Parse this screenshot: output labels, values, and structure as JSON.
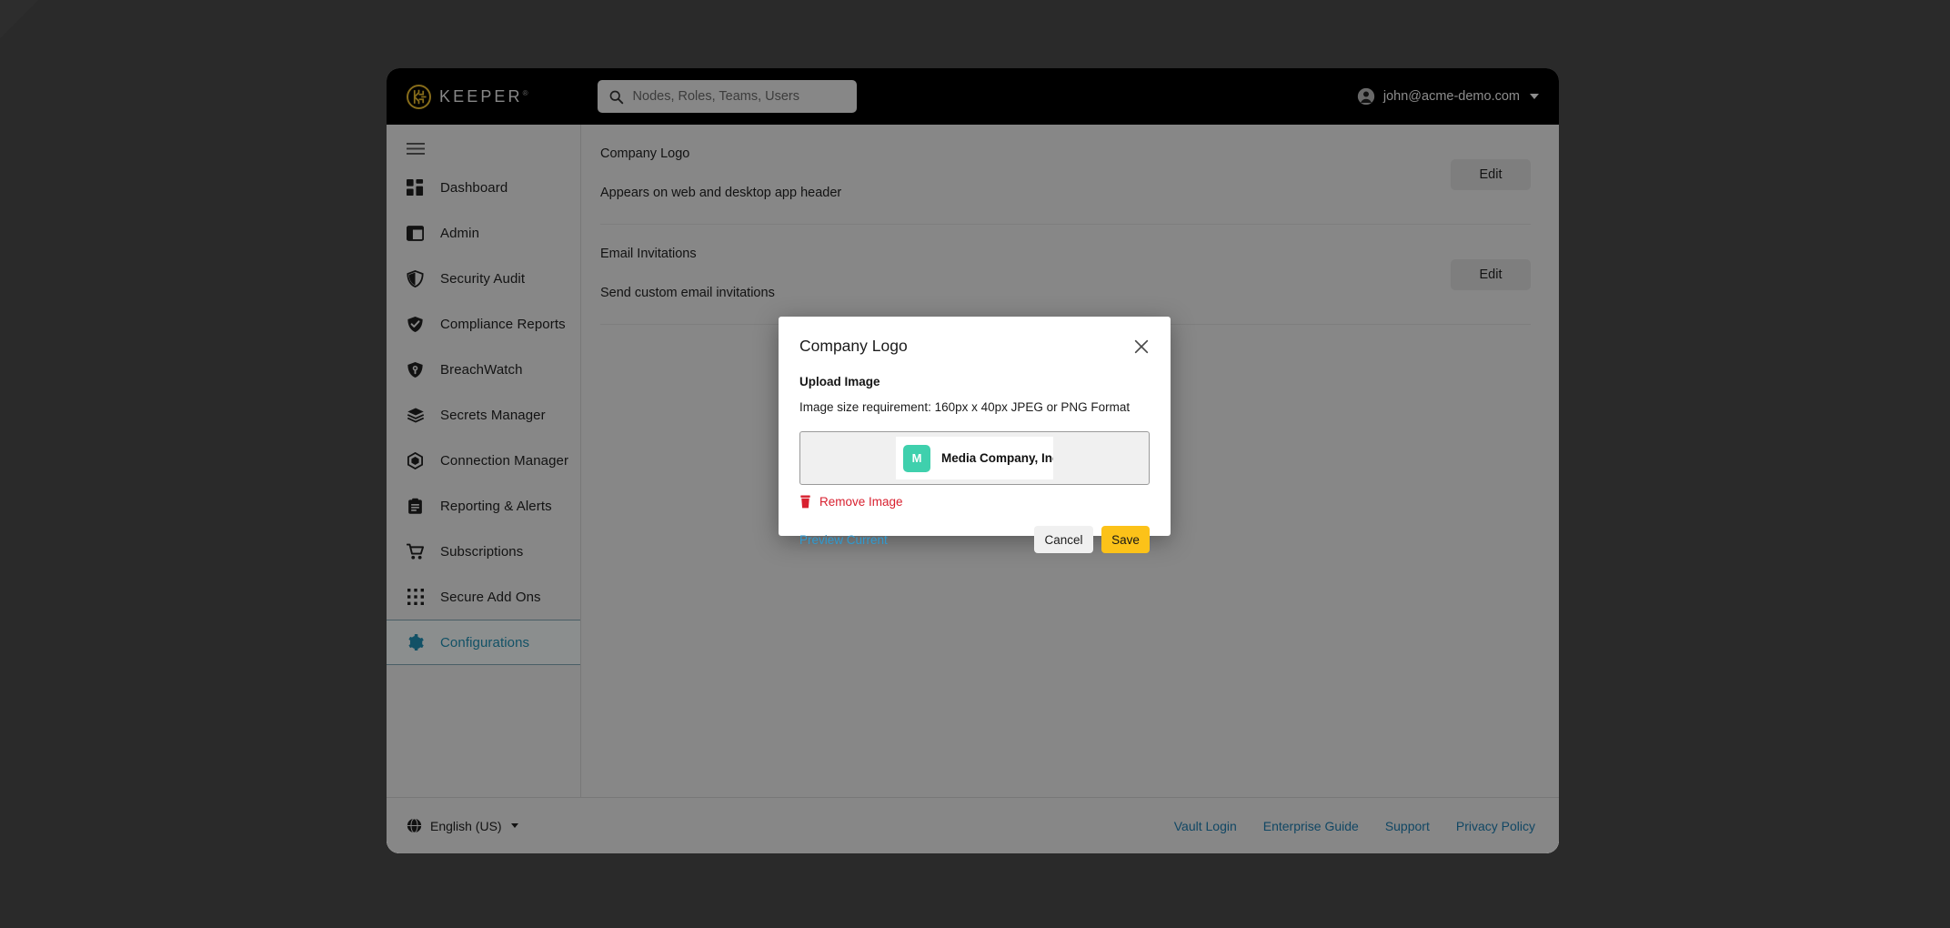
{
  "app": {
    "brand_name": "KEEPER",
    "brand_tm": "®"
  },
  "search": {
    "placeholder": "Nodes, Roles, Teams, Users",
    "value": ""
  },
  "account": {
    "email": "john@acme-demo.com"
  },
  "sidebar": {
    "items": [
      {
        "label": "Dashboard",
        "icon": "dashboard-grid-icon",
        "active": false
      },
      {
        "label": "Admin",
        "icon": "admin-panel-icon",
        "active": false
      },
      {
        "label": "Security Audit",
        "icon": "shield-half-icon",
        "active": false
      },
      {
        "label": "Compliance Reports",
        "icon": "shield-check-icon",
        "active": false
      },
      {
        "label": "BreachWatch",
        "icon": "shield-eye-icon",
        "active": false
      },
      {
        "label": "Secrets Manager",
        "icon": "layers-icon",
        "active": false
      },
      {
        "label": "Connection Manager",
        "icon": "hexagon-icon",
        "active": false
      },
      {
        "label": "Reporting & Alerts",
        "icon": "clipboard-icon",
        "active": false
      },
      {
        "label": "Subscriptions",
        "icon": "cart-icon",
        "active": false
      },
      {
        "label": "Secure Add Ons",
        "icon": "dots-grid-icon",
        "active": false
      },
      {
        "label": "Configurations",
        "icon": "gear-icon",
        "active": true
      }
    ]
  },
  "main": {
    "rows": [
      {
        "title": "Company Logo",
        "description": "Appears on web and desktop app header",
        "action_label": "Edit"
      },
      {
        "title": "Email Invitations",
        "description": "Send custom email invitations",
        "action_label": "Edit"
      }
    ]
  },
  "footer": {
    "language": "English (US)",
    "links": [
      {
        "label": "Vault Login"
      },
      {
        "label": "Enterprise Guide"
      },
      {
        "label": "Support"
      },
      {
        "label": "Privacy Policy"
      }
    ]
  },
  "modal": {
    "title": "Company Logo",
    "upload_label": "Upload Image",
    "requirement": "Image size requirement: 160px x 40px JPEG or PNG Format",
    "logo_preview": {
      "initial": "M",
      "company_name": "Media Company, Inc",
      "square_color": "#3fd0ad"
    },
    "remove_label": "Remove Image",
    "preview_current_label": "Preview Current",
    "cancel_label": "Cancel",
    "save_label": "Save"
  },
  "colors": {
    "brand_gold": "#c9a227",
    "accent_teal": "#1c7a98",
    "save_yellow": "#fcc219",
    "danger_red": "#d8202f",
    "link_blue": "#1a6a96"
  }
}
